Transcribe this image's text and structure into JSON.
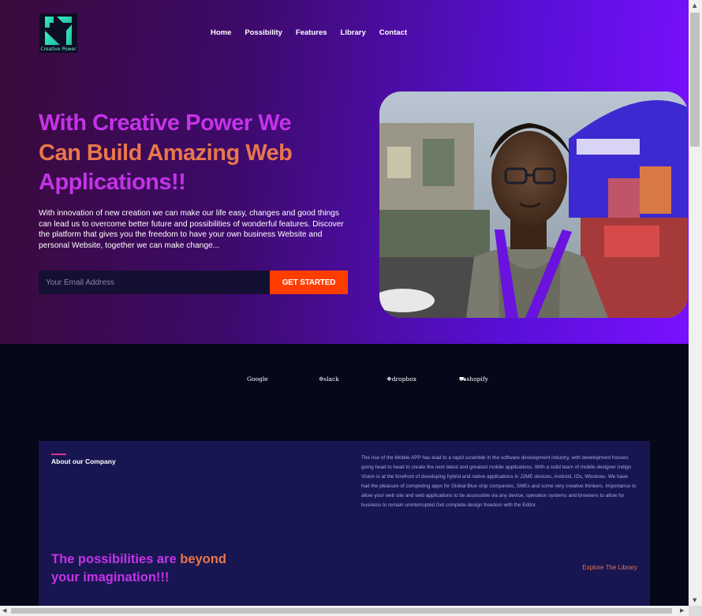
{
  "brand": {
    "logo_text": "Creative Power"
  },
  "nav": {
    "items": [
      "Home",
      "Possibility",
      "Features",
      "Library",
      "Contact"
    ]
  },
  "hero": {
    "headline_line1": "With Creative Power We",
    "headline_line2": "Can Build Amazing Web",
    "headline_line3": "Applications!!",
    "body": "With innovation of new creation we can make our life easy, changes and good things can lead us to overcome better future and possibilities of wonderful features. Discover the platform that gives you the freedom to have your own business Website and personal Website, together we can make change...",
    "email_placeholder": "Your Email Address",
    "cta_label": "GET STARTED"
  },
  "brands": [
    "Google",
    "slack",
    "dropbox",
    "shopify"
  ],
  "about": {
    "title": "About our Company",
    "text": "The rise of the Mobile APP has lead to a rapid scramble in the software development industry, with development houses going head to head to create the next latest and greatest mobile applications. With a solid team of mobile designer Indigo Vision is at the forefront of developing hybrid and native applications in J2ME devices, Android, IOs, Windows. We have had the pleasure of completing apps for Global Blue chip companies, SMEs and some very creative thinkers. Importance to allow your web site and web applications to be accessible via any device, operation systems and browsers to allow for business to remain uninterrupted Get complete design freedom with the Editor.",
    "possibilities_part1": "The possibilities are ",
    "possibilities_part2": "beyond",
    "possibilities_part3": "your imagination!!!",
    "explore_label": "Explore The Library"
  },
  "colors": {
    "accent_pink": "#c433e8",
    "accent_orange": "#e8774a",
    "cta": "#ff3d00",
    "panel": "#181651"
  }
}
